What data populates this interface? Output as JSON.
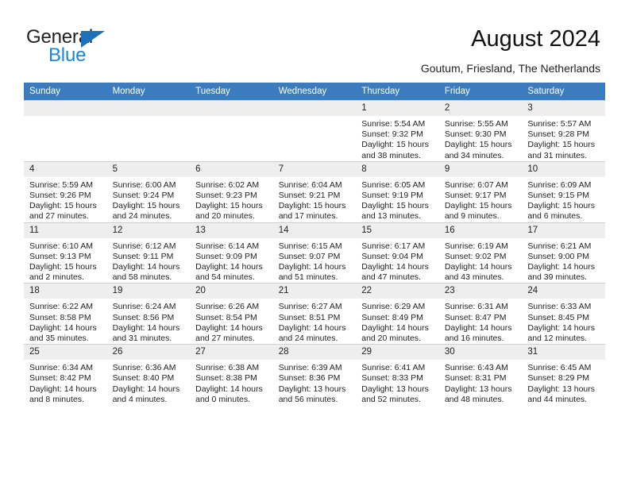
{
  "brand": {
    "name_part1": "General",
    "name_part2": "Blue",
    "triangle_icon": "logo-triangle-icon",
    "color_dark": "#222222",
    "color_blue": "#1b85d6",
    "triangle_color": "#1c71b9"
  },
  "header": {
    "title": "August 2024",
    "subtitle": "Goutum, Friesland, The Netherlands"
  },
  "calendar": {
    "header_bg": "#3a7cbe",
    "daynum_bg": "#eeeeee",
    "weekday_headers": [
      "Sunday",
      "Monday",
      "Tuesday",
      "Wednesday",
      "Thursday",
      "Friday",
      "Saturday"
    ],
    "weeks": [
      [
        {
          "day": "",
          "sunrise": "",
          "sunset": "",
          "daylight": "",
          "empty": true
        },
        {
          "day": "",
          "sunrise": "",
          "sunset": "",
          "daylight": "",
          "empty": true
        },
        {
          "day": "",
          "sunrise": "",
          "sunset": "",
          "daylight": "",
          "empty": true
        },
        {
          "day": "",
          "sunrise": "",
          "sunset": "",
          "daylight": "",
          "empty": true
        },
        {
          "day": "1",
          "sunrise": "Sunrise: 5:54 AM",
          "sunset": "Sunset: 9:32 PM",
          "daylight": "Daylight: 15 hours and 38 minutes."
        },
        {
          "day": "2",
          "sunrise": "Sunrise: 5:55 AM",
          "sunset": "Sunset: 9:30 PM",
          "daylight": "Daylight: 15 hours and 34 minutes."
        },
        {
          "day": "3",
          "sunrise": "Sunrise: 5:57 AM",
          "sunset": "Sunset: 9:28 PM",
          "daylight": "Daylight: 15 hours and 31 minutes."
        }
      ],
      [
        {
          "day": "4",
          "sunrise": "Sunrise: 5:59 AM",
          "sunset": "Sunset: 9:26 PM",
          "daylight": "Daylight: 15 hours and 27 minutes."
        },
        {
          "day": "5",
          "sunrise": "Sunrise: 6:00 AM",
          "sunset": "Sunset: 9:24 PM",
          "daylight": "Daylight: 15 hours and 24 minutes."
        },
        {
          "day": "6",
          "sunrise": "Sunrise: 6:02 AM",
          "sunset": "Sunset: 9:23 PM",
          "daylight": "Daylight: 15 hours and 20 minutes."
        },
        {
          "day": "7",
          "sunrise": "Sunrise: 6:04 AM",
          "sunset": "Sunset: 9:21 PM",
          "daylight": "Daylight: 15 hours and 17 minutes."
        },
        {
          "day": "8",
          "sunrise": "Sunrise: 6:05 AM",
          "sunset": "Sunset: 9:19 PM",
          "daylight": "Daylight: 15 hours and 13 minutes."
        },
        {
          "day": "9",
          "sunrise": "Sunrise: 6:07 AM",
          "sunset": "Sunset: 9:17 PM",
          "daylight": "Daylight: 15 hours and 9 minutes."
        },
        {
          "day": "10",
          "sunrise": "Sunrise: 6:09 AM",
          "sunset": "Sunset: 9:15 PM",
          "daylight": "Daylight: 15 hours and 6 minutes."
        }
      ],
      [
        {
          "day": "11",
          "sunrise": "Sunrise: 6:10 AM",
          "sunset": "Sunset: 9:13 PM",
          "daylight": "Daylight: 15 hours and 2 minutes."
        },
        {
          "day": "12",
          "sunrise": "Sunrise: 6:12 AM",
          "sunset": "Sunset: 9:11 PM",
          "daylight": "Daylight: 14 hours and 58 minutes."
        },
        {
          "day": "13",
          "sunrise": "Sunrise: 6:14 AM",
          "sunset": "Sunset: 9:09 PM",
          "daylight": "Daylight: 14 hours and 54 minutes."
        },
        {
          "day": "14",
          "sunrise": "Sunrise: 6:15 AM",
          "sunset": "Sunset: 9:07 PM",
          "daylight": "Daylight: 14 hours and 51 minutes."
        },
        {
          "day": "15",
          "sunrise": "Sunrise: 6:17 AM",
          "sunset": "Sunset: 9:04 PM",
          "daylight": "Daylight: 14 hours and 47 minutes."
        },
        {
          "day": "16",
          "sunrise": "Sunrise: 6:19 AM",
          "sunset": "Sunset: 9:02 PM",
          "daylight": "Daylight: 14 hours and 43 minutes."
        },
        {
          "day": "17",
          "sunrise": "Sunrise: 6:21 AM",
          "sunset": "Sunset: 9:00 PM",
          "daylight": "Daylight: 14 hours and 39 minutes."
        }
      ],
      [
        {
          "day": "18",
          "sunrise": "Sunrise: 6:22 AM",
          "sunset": "Sunset: 8:58 PM",
          "daylight": "Daylight: 14 hours and 35 minutes."
        },
        {
          "day": "19",
          "sunrise": "Sunrise: 6:24 AM",
          "sunset": "Sunset: 8:56 PM",
          "daylight": "Daylight: 14 hours and 31 minutes."
        },
        {
          "day": "20",
          "sunrise": "Sunrise: 6:26 AM",
          "sunset": "Sunset: 8:54 PM",
          "daylight": "Daylight: 14 hours and 27 minutes."
        },
        {
          "day": "21",
          "sunrise": "Sunrise: 6:27 AM",
          "sunset": "Sunset: 8:51 PM",
          "daylight": "Daylight: 14 hours and 24 minutes."
        },
        {
          "day": "22",
          "sunrise": "Sunrise: 6:29 AM",
          "sunset": "Sunset: 8:49 PM",
          "daylight": "Daylight: 14 hours and 20 minutes."
        },
        {
          "day": "23",
          "sunrise": "Sunrise: 6:31 AM",
          "sunset": "Sunset: 8:47 PM",
          "daylight": "Daylight: 14 hours and 16 minutes."
        },
        {
          "day": "24",
          "sunrise": "Sunrise: 6:33 AM",
          "sunset": "Sunset: 8:45 PM",
          "daylight": "Daylight: 14 hours and 12 minutes."
        }
      ],
      [
        {
          "day": "25",
          "sunrise": "Sunrise: 6:34 AM",
          "sunset": "Sunset: 8:42 PM",
          "daylight": "Daylight: 14 hours and 8 minutes."
        },
        {
          "day": "26",
          "sunrise": "Sunrise: 6:36 AM",
          "sunset": "Sunset: 8:40 PM",
          "daylight": "Daylight: 14 hours and 4 minutes."
        },
        {
          "day": "27",
          "sunrise": "Sunrise: 6:38 AM",
          "sunset": "Sunset: 8:38 PM",
          "daylight": "Daylight: 14 hours and 0 minutes."
        },
        {
          "day": "28",
          "sunrise": "Sunrise: 6:39 AM",
          "sunset": "Sunset: 8:36 PM",
          "daylight": "Daylight: 13 hours and 56 minutes."
        },
        {
          "day": "29",
          "sunrise": "Sunrise: 6:41 AM",
          "sunset": "Sunset: 8:33 PM",
          "daylight": "Daylight: 13 hours and 52 minutes."
        },
        {
          "day": "30",
          "sunrise": "Sunrise: 6:43 AM",
          "sunset": "Sunset: 8:31 PM",
          "daylight": "Daylight: 13 hours and 48 minutes."
        },
        {
          "day": "31",
          "sunrise": "Sunrise: 6:45 AM",
          "sunset": "Sunset: 8:29 PM",
          "daylight": "Daylight: 13 hours and 44 minutes."
        }
      ]
    ]
  }
}
